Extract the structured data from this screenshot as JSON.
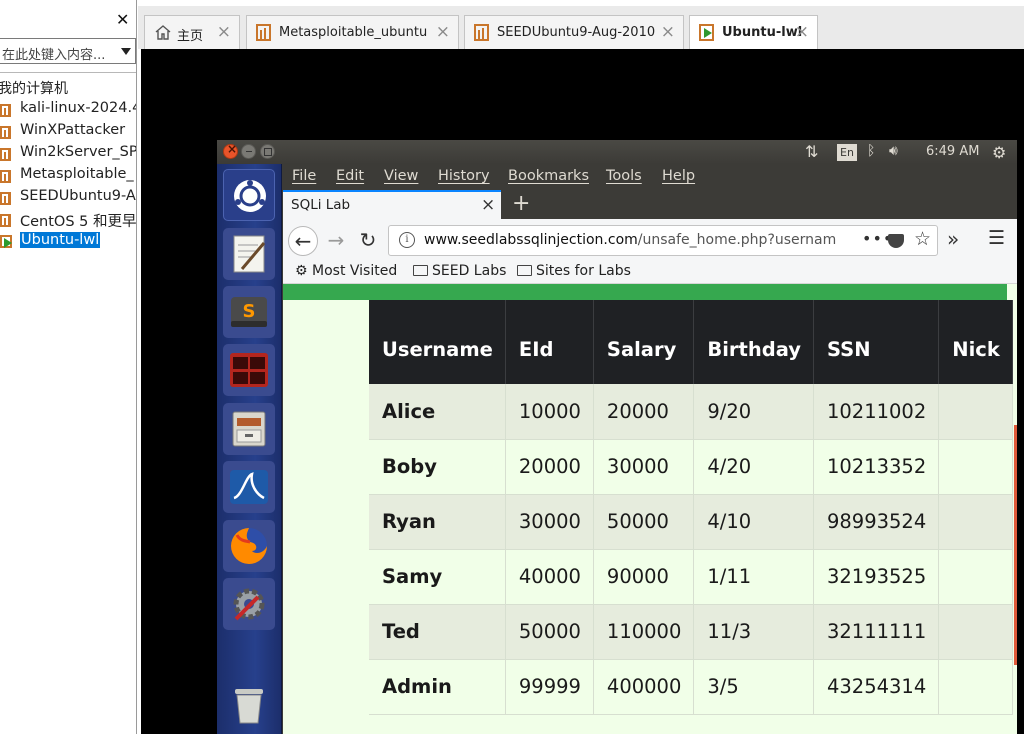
{
  "library": {
    "search_placeholder": "在此处键入内容...",
    "root_label": "我的计算机",
    "items": [
      {
        "label": "kali-linux-2024.4"
      },
      {
        "label": "WinXPattacker"
      },
      {
        "label": "Win2kServer_SP"
      },
      {
        "label": "Metasploitable_"
      },
      {
        "label": "SEEDUbuntu9-A"
      },
      {
        "label": "CentOS 5 和更早"
      },
      {
        "label": "Ubuntu-lwl"
      }
    ]
  },
  "tabs": [
    {
      "label": "主页"
    },
    {
      "label": "Metasploitable_ubuntu"
    },
    {
      "label": "SEEDUbuntu9-Aug-2010"
    },
    {
      "label": "Ubuntu-lwl"
    }
  ],
  "ubuntu": {
    "keyboard_indicator": "En",
    "clock": "6:49 AM"
  },
  "firefox": {
    "menu": [
      "File",
      "Edit",
      "View",
      "History",
      "Bookmarks",
      "Tools",
      "Help"
    ],
    "tab_title": "SQLi Lab",
    "url_host": "www.seedlabssqlinjection.com",
    "url_path": "/unsafe_home.php?usernam",
    "bookmarks": [
      "Most Visited",
      "SEED Labs",
      "Sites for Labs"
    ]
  },
  "table": {
    "headers": [
      "Username",
      "EId",
      "Salary",
      "Birthday",
      "SSN",
      "Nick"
    ],
    "rows": [
      [
        "Alice",
        "10000",
        "20000",
        "9/20",
        "10211002",
        ""
      ],
      [
        "Boby",
        "20000",
        "30000",
        "4/20",
        "10213352",
        ""
      ],
      [
        "Ryan",
        "30000",
        "50000",
        "4/10",
        "98993524",
        ""
      ],
      [
        "Samy",
        "40000",
        "90000",
        "1/11",
        "32193525",
        ""
      ],
      [
        "Ted",
        "50000",
        "110000",
        "11/3",
        "32111111",
        ""
      ],
      [
        "Admin",
        "99999",
        "400000",
        "3/5",
        "43254314",
        ""
      ]
    ]
  },
  "colors": {
    "accent_green": "#36a84f",
    "table_header": "#1f2124",
    "ubuntu_close": "#e9542a",
    "selection": "#0078d7"
  },
  "icons": {
    "launcher": [
      "ubuntu-dash-icon",
      "text-editor-icon",
      "sublime-text-icon",
      "terminal-icon",
      "files-icon",
      "wireshark-icon",
      "firefox-icon",
      "settings-icon",
      "trash-icon"
    ]
  }
}
